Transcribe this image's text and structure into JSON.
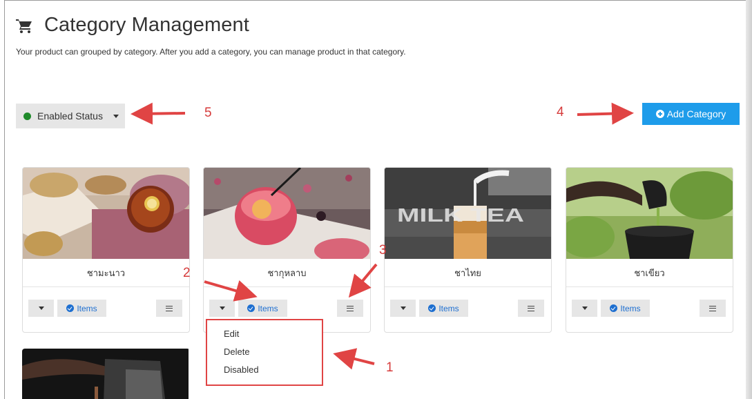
{
  "page": {
    "title": "Category Management",
    "subtitle": "Your product can grouped by category. After you add a category, you can manage product in that category."
  },
  "toolbar": {
    "status_label": "Enabled Status",
    "add_label": "Add Category"
  },
  "cards": [
    {
      "name": "ชามะนาว",
      "items_label": "Items"
    },
    {
      "name": "ชากุหลาบ",
      "items_label": "Items"
    },
    {
      "name": "ชาไทย",
      "items_label": "Items"
    },
    {
      "name": "ชาเขียว",
      "items_label": "Items"
    }
  ],
  "card3_image_text": "MILK TEA",
  "dropdown": {
    "items": [
      "Edit",
      "Delete",
      "Disabled"
    ]
  },
  "annotations": [
    "1",
    "2",
    "3",
    "4",
    "5"
  ],
  "colors": {
    "accent": "#1e9cea",
    "status_dot": "#1f8a2a",
    "annotation": "#e04444"
  },
  "icons": [
    "cart-icon",
    "status-dot-icon",
    "plus-circle-icon",
    "caret-down-icon",
    "check-circle-icon",
    "hamburger-icon"
  ]
}
